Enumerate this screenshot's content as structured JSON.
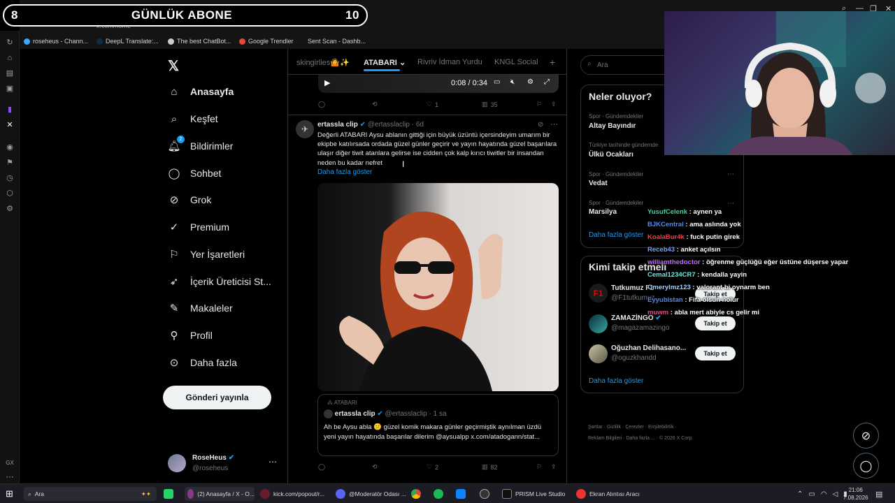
{
  "overlay": {
    "sub_count_left": "8",
    "sub_label": "GÜNLÜK ABONE",
    "sub_count_right": "10"
  },
  "browser": {
    "url": "x.com/home",
    "bookmarks": [
      "roseheus - Chann...",
      "DeepL Translate:...",
      "The best ChatBot...",
      "Google Trendler",
      "Sent Scan - Dashb..."
    ]
  },
  "nav": {
    "home": "Anasayfa",
    "explore": "Keşfet",
    "notifications": "Bildirimler",
    "notif_badge": "2",
    "chat": "Sohbet",
    "grok": "Grok",
    "premium": "Premium",
    "bookmarks": "Yer İşaretleri",
    "creator": "İçerik Üreticisi St...",
    "articles": "Makaleler",
    "profile": "Profil",
    "more": "Daha fazla",
    "post_button": "Gönderi yayınla"
  },
  "account": {
    "name": "RoseHeus",
    "handle": "@roseheus"
  },
  "timeline": {
    "tabs": [
      "skingirlies🤷✨",
      "ATABARI",
      "Rivriv İdman Yurdu",
      "KNGL Social"
    ],
    "video_time": "0:08 / 0:34",
    "prev_stats": {
      "likes": "1",
      "views": "35"
    },
    "tweet": {
      "name": "ertassla clip",
      "handle": "@ertasslaclip",
      "time": "· 6d",
      "text": "Değerli ATABARI Aysu ablanın gittiği için büyük üzüntü içersindeyim umarım bir ekipbe katılırsada  ordada güzel günler geçirir ve yayın hayatında güzel başarılara ulaşır diğer  tiwit atanlara gelirse ise cidden çok kalp kırıcı tiwitler bir insandan neden bu kadar nefret",
      "show_more": "Daha fazla göster",
      "quote": {
        "context": "ATABARI",
        "name": "ertassla clip",
        "handle": "@ertasslaclip",
        "time": "· 1 sa",
        "text": "Ah be Aysu abla 😕 güzel komik makara günler geçirmiştik aynılman üzdü yeni yayın hayatında başarılar dilerim @aysualpp x.com/atadogann/stat..."
      },
      "stats": {
        "likes": "2",
        "views": "82"
      }
    }
  },
  "sidebar": {
    "search_placeholder": "Ara",
    "trends_title": "Neler oluyor?",
    "trends": [
      {
        "cat": "Spor · Gündemdekiler",
        "name": "Altay Bayındır"
      },
      {
        "cat": "Türkiye tarihinde gündemde",
        "name": "Ülkü Ocakları"
      },
      {
        "cat": "Spor · Gündemdekiler",
        "name": "Vedat"
      },
      {
        "cat": "Spor · Gündemdekiler",
        "name": "Marsilya"
      }
    ],
    "trends_more": "Daha fazla göster",
    "who_title": "Kimi takip etmeli",
    "who": [
      {
        "name": "Tutkumuz F1",
        "handle": "@F1tutkumuz",
        "button": "Takip et"
      },
      {
        "name": "ZAMAZİNGO",
        "handle": "@magazamazingo",
        "button": "Takip et"
      },
      {
        "name": "Oğuzhan Delihasano...",
        "handle": "@oguzkhandd",
        "button": "Takip et"
      }
    ],
    "who_more": "Daha fazla göster",
    "footer": [
      "Şartlar",
      "Gizlilik",
      "Çerezler",
      "Erişilebilirlik",
      "Reklam Bilgileri",
      "Daha fazla ...",
      "© 2026 X Corp."
    ]
  },
  "chat": [
    {
      "user": "YusufCelenk",
      "color": "#3ad6a0",
      "msg": "aynen ya"
    },
    {
      "user": "BJKCentral",
      "color": "#4a8cff",
      "msg": "ama aslında yok"
    },
    {
      "user": "KoalaBur4k",
      "color": "#ff3b3b",
      "msg": "fuck putin girek"
    },
    {
      "user": "Receb43",
      "color": "#7b9cff",
      "msg": "anket açılsın"
    },
    {
      "user": "williamthedoctor",
      "color": "#c06cff",
      "msg": "öğrenme güçlüğü eğer üstüne düşerse yapar"
    },
    {
      "user": "Cemal1234CR7",
      "color": "#5ff0e0",
      "msg": "kendalla yayin"
    },
    {
      "user": "Omerylmz123",
      "color": "#9fd0ff",
      "msg": "valorant bi oynarm ben"
    },
    {
      "user": "Eyyubistan",
      "color": "#4a8cff",
      "msg": "Fifa olsun nolur"
    },
    {
      "user": "muwm",
      "color": "#ff3b8f",
      "msg": "abla mert abiyle cs gelir mi"
    }
  ],
  "taskbar": {
    "search": "Ara",
    "apps": [
      "(2) Anasayfa / X - O...",
      "kick.com/popout/r...",
      "@Moderatör Odası ...",
      "PRISM Live Studio",
      "Ekran Alıntısı Aracı"
    ],
    "time": "21:06",
    "date": "7.08.2026"
  }
}
